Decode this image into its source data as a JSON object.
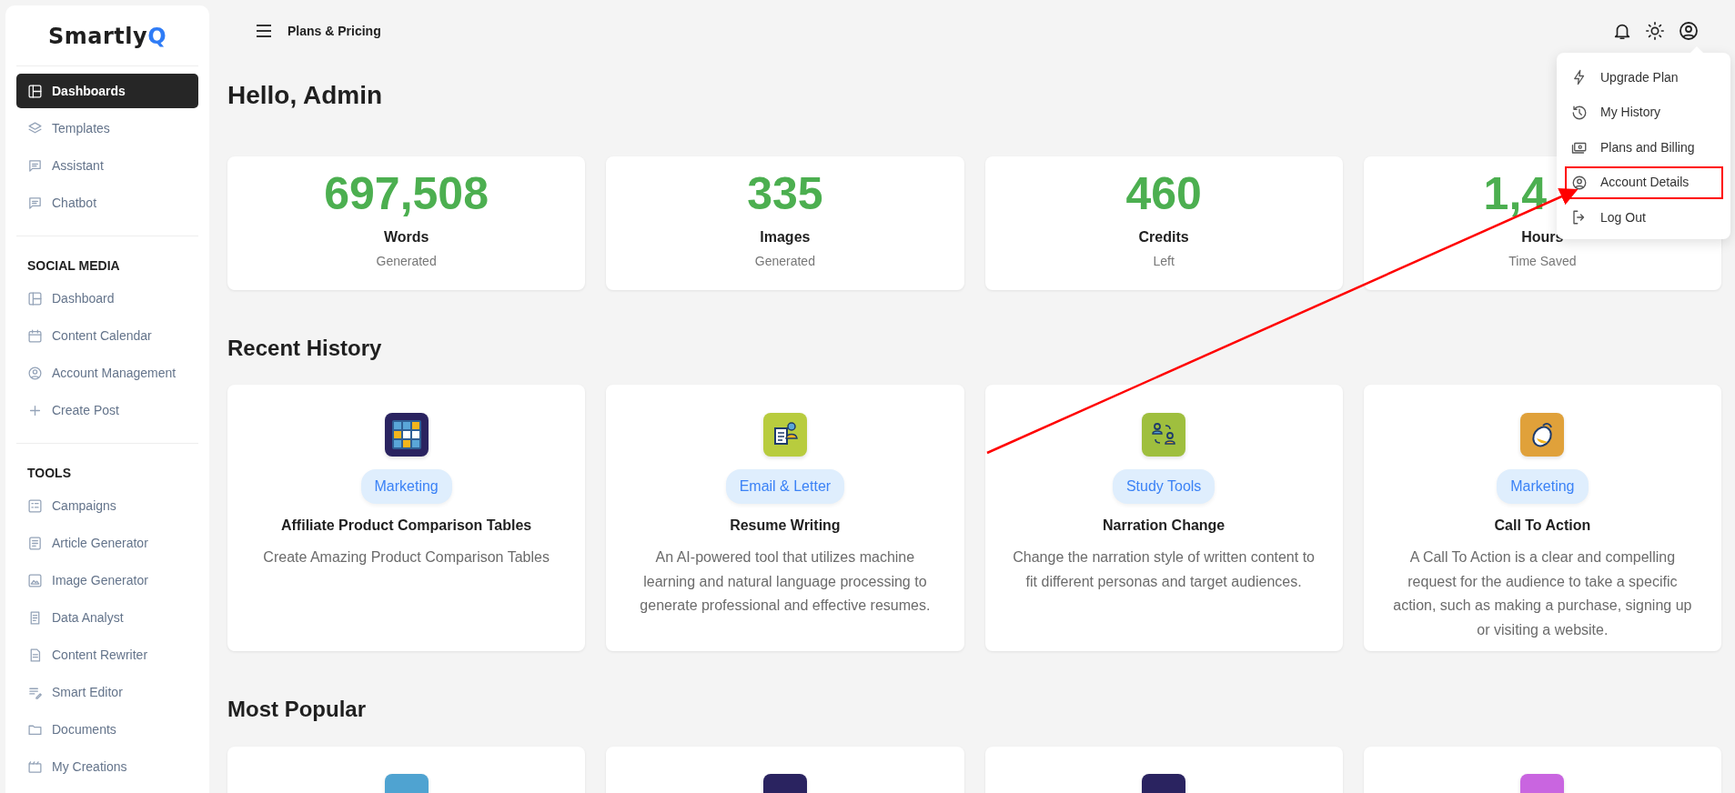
{
  "sidebar": {
    "logo": {
      "text": "Smartly",
      "accent": "Q"
    },
    "sections": [
      {
        "items": [
          {
            "label": "Dashboards",
            "selected": true
          },
          {
            "label": "Templates",
            "selected": false
          },
          {
            "label": "Assistant",
            "selected": false
          },
          {
            "label": "Chatbot",
            "selected": false
          }
        ]
      },
      {
        "title": "SOCIAL MEDIA",
        "items": [
          {
            "label": "Dashboard",
            "selected": false
          },
          {
            "label": "Content Calendar",
            "selected": false
          },
          {
            "label": "Account Management",
            "selected": false
          },
          {
            "label": "Create Post",
            "selected": false
          }
        ]
      },
      {
        "title": "TOOLS",
        "items": [
          {
            "label": "Campaigns",
            "selected": false
          },
          {
            "label": "Article Generator",
            "selected": false
          },
          {
            "label": "Image Generator",
            "selected": false
          },
          {
            "label": "Data Analyst",
            "selected": false
          },
          {
            "label": "Content Rewriter",
            "selected": false
          },
          {
            "label": "Smart Editor",
            "selected": false
          },
          {
            "label": "Documents",
            "selected": false
          },
          {
            "label": "My Creations",
            "selected": false
          }
        ]
      }
    ]
  },
  "header": {
    "breadcrumb": "Plans & Pricing"
  },
  "user_menu": {
    "items": [
      {
        "label": "Upgrade Plan",
        "highlighted": false
      },
      {
        "label": "My History",
        "highlighted": false
      },
      {
        "label": "Plans and Billing",
        "highlighted": false
      },
      {
        "label": "Account Details",
        "highlighted": true
      },
      {
        "label": "Log Out",
        "highlighted": false
      }
    ]
  },
  "greeting": "Hello, Admin",
  "stats": [
    {
      "value": "697,508",
      "label": "Words",
      "sub": "Generated"
    },
    {
      "value": "335",
      "label": "Images",
      "sub": "Generated"
    },
    {
      "value": "460",
      "label": "Credits",
      "sub": "Left"
    },
    {
      "value": "1,4",
      "label": "Hours",
      "sub": "Time Saved"
    }
  ],
  "recent_history": {
    "title": "Recent History",
    "cards": [
      {
        "color": "#2a2360",
        "category": "Marketing",
        "title": "Affiliate Product Comparison Tables",
        "description": "Create Amazing Product Comparison Tables"
      },
      {
        "color": "#b8cc3e",
        "category": "Email & Letter",
        "title": "Resume Writing",
        "description": "An AI-powered tool that utilizes machine learning and natural language processing to generate professional and effective resumes."
      },
      {
        "color": "#9fbf3e",
        "category": "Study Tools",
        "title": "Narration Change",
        "description": "Change the narration style of written content to fit different personas and target audiences."
      },
      {
        "color": "#e0a13a",
        "category": "Marketing",
        "title": "Call To Action",
        "description": "A Call To Action is a clear and compelling request for the audience to take a specific action, such as making a purchase, signing up or visiting a website."
      }
    ]
  },
  "most_popular": {
    "title": "Most Popular",
    "cards": [
      {
        "color": "#4fa3d1"
      },
      {
        "color": "#2a2360"
      },
      {
        "color": "#2a2360"
      },
      {
        "color": "#c965e0"
      }
    ]
  }
}
